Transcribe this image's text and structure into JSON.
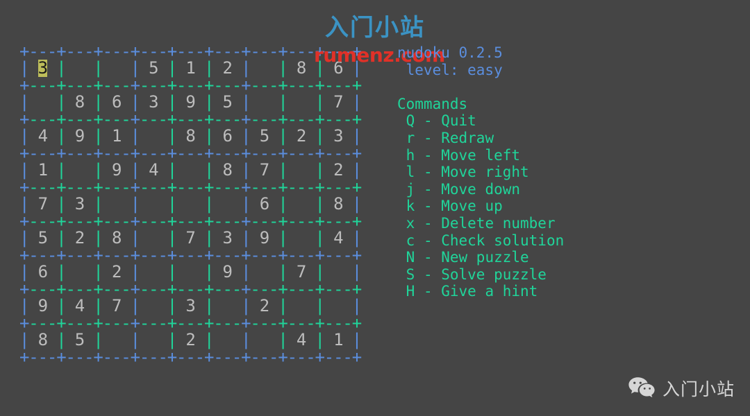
{
  "page": {
    "background_color": "#454545",
    "site_title": "入门小站",
    "site_title_color": "#3b93c4",
    "watermark": "rumenz.com",
    "watermark_color": "#e03128"
  },
  "app": {
    "name_version": "nudoku 0.2.5",
    "level_line": "level: easy",
    "header_color": "#5b8ede"
  },
  "commands": {
    "heading": "Commands",
    "color": "#20d59a",
    "items": [
      {
        "key": "Q",
        "dash": "-",
        "action": "Quit"
      },
      {
        "key": "r",
        "dash": "-",
        "action": "Redraw"
      },
      {
        "key": "h",
        "dash": "-",
        "action": "Move left"
      },
      {
        "key": "l",
        "dash": "-",
        "action": "Move right"
      },
      {
        "key": "j",
        "dash": "-",
        "action": "Move down"
      },
      {
        "key": "k",
        "dash": "-",
        "action": "Move up"
      },
      {
        "key": "x",
        "dash": "-",
        "action": "Delete number"
      },
      {
        "key": "c",
        "dash": "-",
        "action": "Check solution"
      },
      {
        "key": "N",
        "dash": "-",
        "action": "New puzzle"
      },
      {
        "key": "S",
        "dash": "-",
        "action": "Solve puzzle"
      },
      {
        "key": "H",
        "dash": "-",
        "action": "Give a hint"
      }
    ]
  },
  "board": {
    "box_border_color": "#5b8ede",
    "cell_border_color": "#20d59a",
    "number_color": "#bdbdbd",
    "cursor_bg": "#bdbd5a",
    "cursor_fg": "#1a1a1a",
    "cursor": {
      "row": 0,
      "col": 0
    },
    "grid": [
      [
        "3",
        "",
        "",
        "5",
        "1",
        "2",
        "",
        "8",
        "6"
      ],
      [
        "",
        "8",
        "6",
        "3",
        "9",
        "5",
        "",
        "",
        "7"
      ],
      [
        "4",
        "9",
        "1",
        "",
        "8",
        "6",
        "5",
        "2",
        "3"
      ],
      [
        "1",
        "",
        "9",
        "4",
        "",
        "8",
        "7",
        "",
        "2"
      ],
      [
        "7",
        "3",
        "",
        "",
        "",
        "",
        "6",
        "",
        "8"
      ],
      [
        "5",
        "2",
        "8",
        "",
        "7",
        "3",
        "9",
        "",
        "4"
      ],
      [
        "6",
        "",
        "2",
        "",
        "",
        "9",
        "",
        "7",
        ""
      ],
      [
        "9",
        "4",
        "7",
        "",
        "3",
        "",
        "2",
        "",
        ""
      ],
      [
        "8",
        "5",
        "",
        "",
        "2",
        "",
        "",
        "4",
        "1"
      ]
    ]
  },
  "footer": {
    "wechat_icon": "wechat-icon",
    "label": "入门小站"
  }
}
